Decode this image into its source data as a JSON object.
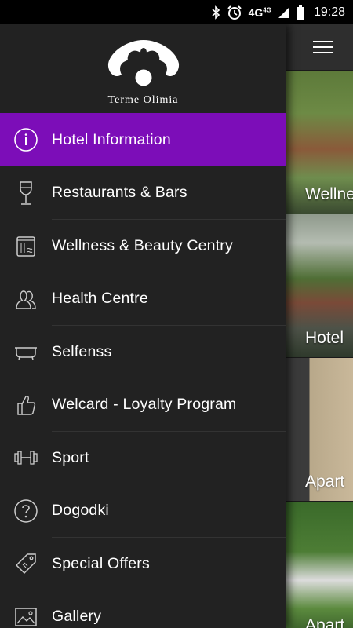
{
  "status_bar": {
    "network": "4G",
    "network_sup": "4G",
    "time": "19:28"
  },
  "brand": {
    "name": "Terme Olimia"
  },
  "menu": {
    "items": [
      {
        "label": "Hotel Information",
        "icon": "info-icon",
        "active": true
      },
      {
        "label": "Restaurants & Bars",
        "icon": "wine-glass-icon",
        "active": false
      },
      {
        "label": "Wellness & Beauty Centry",
        "icon": "towel-icon",
        "active": false
      },
      {
        "label": "Health Centre",
        "icon": "people-icon",
        "active": false
      },
      {
        "label": "Selfenss",
        "icon": "bathtub-icon",
        "active": false
      },
      {
        "label": "Welcard - Loyalty Program",
        "icon": "thumbs-up-icon",
        "active": false
      },
      {
        "label": "Sport",
        "icon": "dumbbell-icon",
        "active": false
      },
      {
        "label": "Dogodki",
        "icon": "question-icon",
        "active": false
      },
      {
        "label": "Special Offers",
        "icon": "tag-icon",
        "active": false
      },
      {
        "label": "Gallery",
        "icon": "image-icon",
        "active": false
      }
    ]
  },
  "content": {
    "tiles": [
      {
        "label": "Wellness"
      },
      {
        "label": "Hotel"
      },
      {
        "label": "Apart"
      },
      {
        "label": "Apart"
      }
    ]
  },
  "colors": {
    "accent": "#7c0db8",
    "drawer_bg": "#222222",
    "text": "#ffffff"
  }
}
